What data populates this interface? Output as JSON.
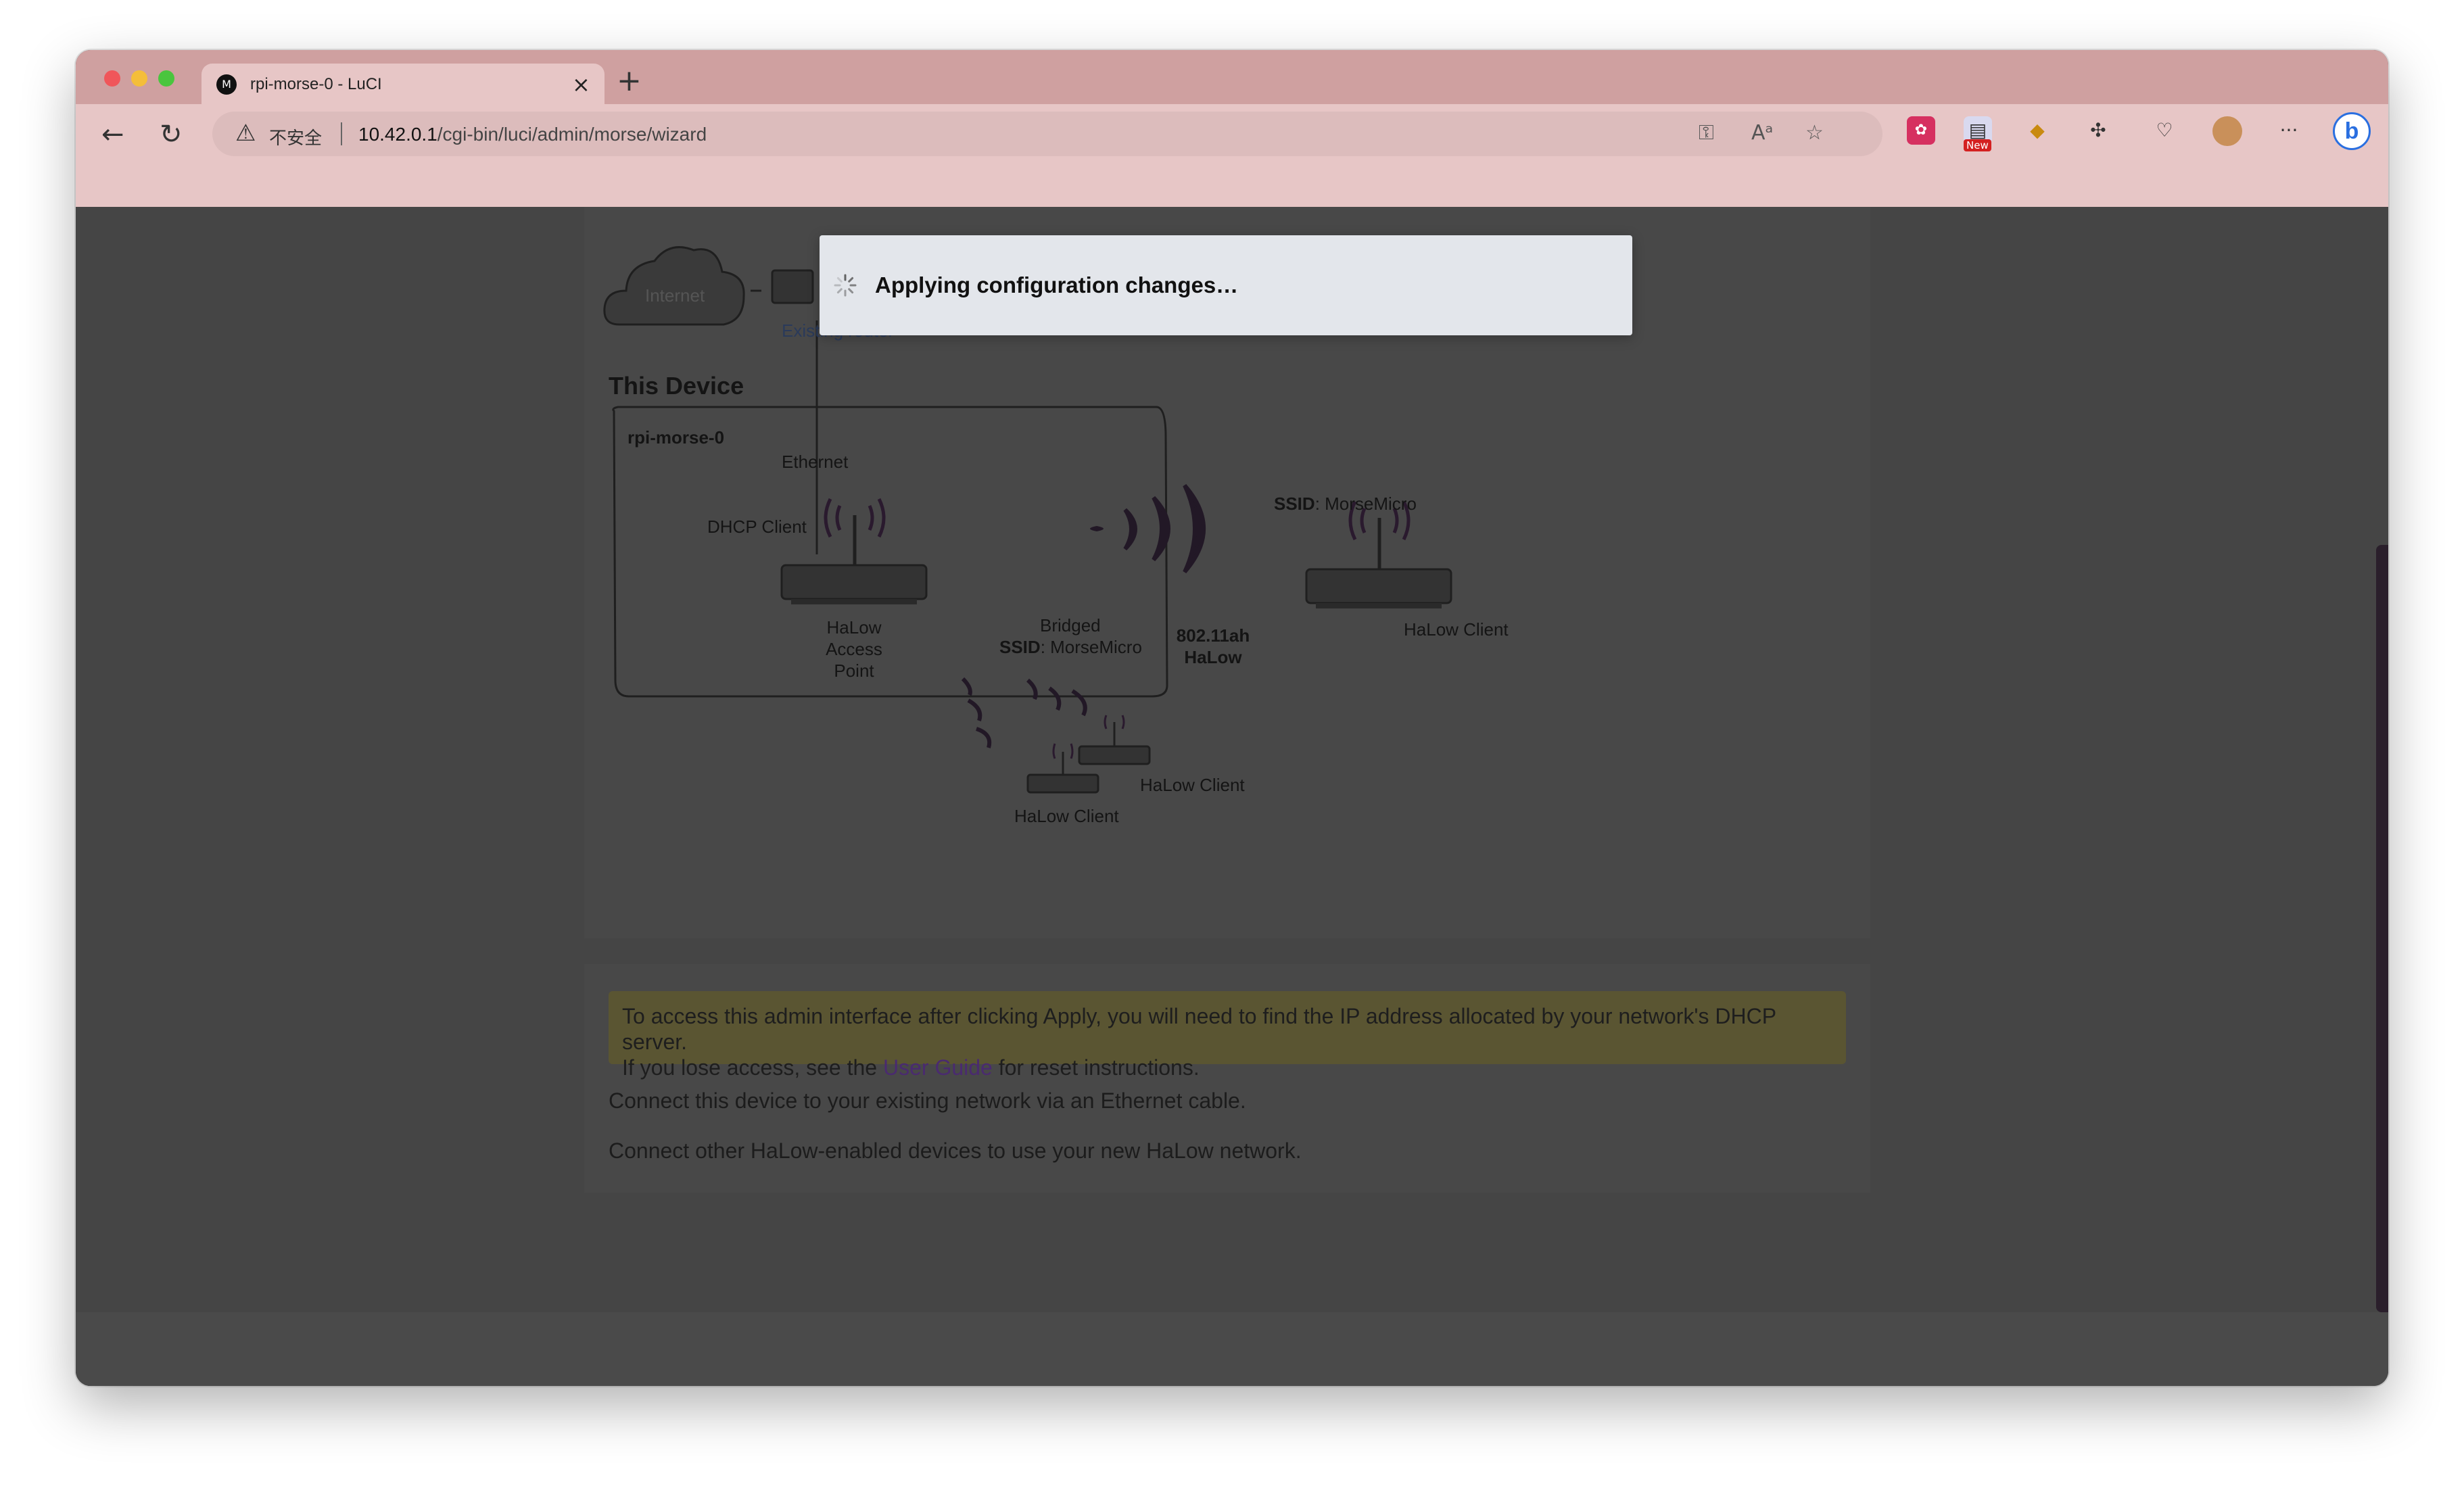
{
  "browser": {
    "tab_title": "rpi-morse-0 - LuCI",
    "tab_close": "×",
    "new_tab": "+",
    "security_label": "不安全",
    "url_host": "10.42.0.1",
    "url_path": "/cgi-bin/luci/admin/morse/wizard",
    "new_badge": "New",
    "menu_label": "···"
  },
  "dialog": {
    "message": "Applying configuration changes…"
  },
  "diagram": {
    "internet_label": "Internet",
    "existing_router_label": "Existing router",
    "this_device_heading": "This Device",
    "hostname": "rpi-morse-0",
    "ethernet_label": "Ethernet",
    "dhcp_client_label": "DHCP Client",
    "access_point_label": [
      "HaLow",
      "Access",
      "Point"
    ],
    "bridged_label": "Bridged",
    "ssid_key": "SSID",
    "ssid_value": ": MorseMicro",
    "band_label": [
      "802.11ah",
      "HaLow"
    ],
    "remote_ssid_key": "SSID",
    "remote_ssid_value": ": MorseMicro",
    "halow_client_right": "HaLow Client",
    "halow_client_mid": "HaLow Client",
    "halow_client_bottom": "HaLow Client"
  },
  "instructions": {
    "warning_line1": "To access this admin interface after clicking Apply, you will need to find the IP address allocated by your network's DHCP server.",
    "warning_line2_before": "If you lose access, see the ",
    "warning_link": "User Guide",
    "warning_line2_after": " for reset instructions.",
    "note1": "Connect this device to your existing network via an Ethernet cable.",
    "note2": "Connect other HaLow-enabled devices to use your new HaLow network."
  },
  "colors": {
    "titlebar": "#cfa0a0",
    "toolbar": "#e7c6c6",
    "page_dim": "#434343",
    "dialog_bg": "#e3e6eb",
    "warning_bg": "#5a5532",
    "link": "#4a2a70"
  }
}
